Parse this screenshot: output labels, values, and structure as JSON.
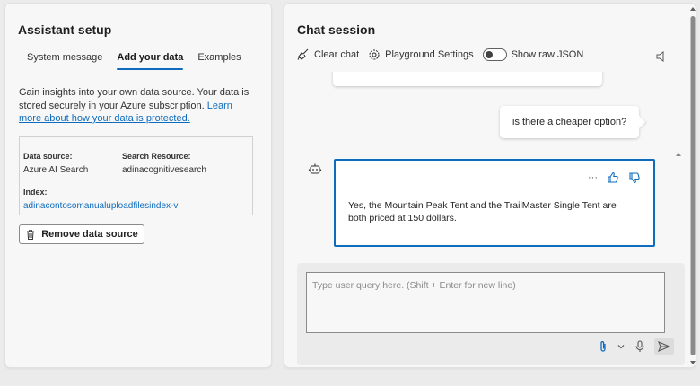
{
  "assistant_setup": {
    "title": "Assistant setup",
    "tabs": [
      {
        "label": "System message"
      },
      {
        "label": "Add your data"
      },
      {
        "label": "Examples"
      }
    ],
    "description": "Gain insights into your own data source. Your data is stored securely in your Azure subscription.",
    "learn_more_link": "Learn more about how your data is protected.",
    "data_source_label": "Data source:",
    "data_source_value": "Azure AI Search",
    "search_resource_label": "Search Resource:",
    "search_resource_value": "adinacognitivesearch",
    "index_label": "Index:",
    "index_value": "adinacontosomanualuploadfilesindex-v",
    "remove_button": "Remove data source"
  },
  "chat_session": {
    "title": "Chat session",
    "toolbar": {
      "clear_chat": "Clear chat",
      "playground_settings": "Playground Settings",
      "show_raw_json": "Show raw JSON",
      "raw_json_on": false
    },
    "messages": [
      {
        "role": "user",
        "text": "is there a cheaper option?"
      },
      {
        "role": "assistant",
        "text": "Yes, the Mountain Peak Tent and the TrailMaster Single Tent are both priced at 150 dollars."
      }
    ],
    "assistant_more": "···",
    "input_placeholder": "Type user query here. (Shift + Enter for new line)"
  },
  "colors": {
    "accent": "#0f6cbd",
    "panel_bg": "#f7f7f7",
    "page_bg": "#ebebeb"
  },
  "icons": [
    "broom-icon",
    "gear-icon",
    "speaker-icon",
    "person-icon",
    "bot-icon",
    "thumbs-up-icon",
    "thumbs-down-icon",
    "trash-icon",
    "paperclip-icon",
    "chevron-down-icon",
    "microphone-icon",
    "send-icon"
  ]
}
